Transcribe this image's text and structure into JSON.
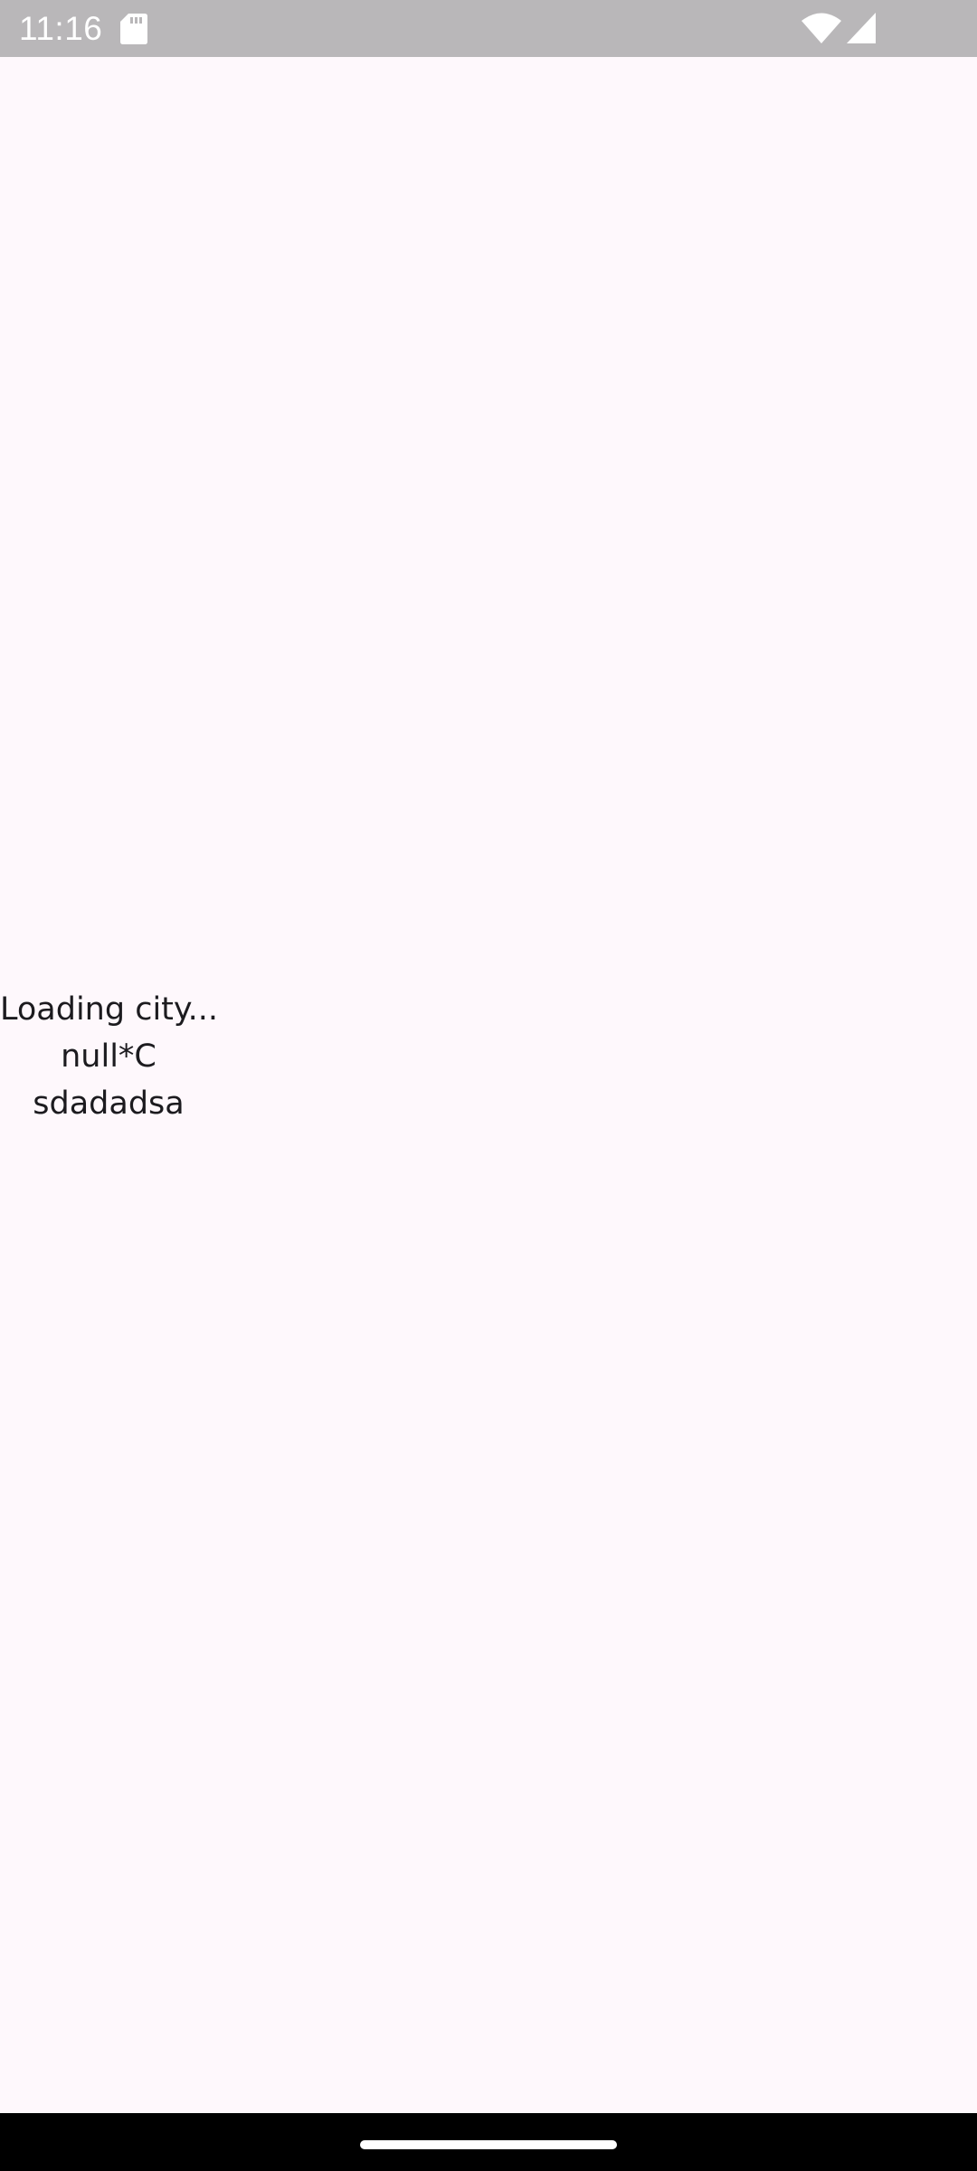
{
  "status_bar": {
    "time": "11:16",
    "icons": [
      "sd-card-icon",
      "wifi-icon",
      "signal-icon"
    ]
  },
  "main": {
    "city": "Loading city...",
    "temperature": "null*C",
    "description": "sdadadsa"
  },
  "colors": {
    "background": "#fef8fc",
    "status_bar": "#b9b7b9",
    "text": "#1c1b1f",
    "nav_bar": "#000000"
  }
}
